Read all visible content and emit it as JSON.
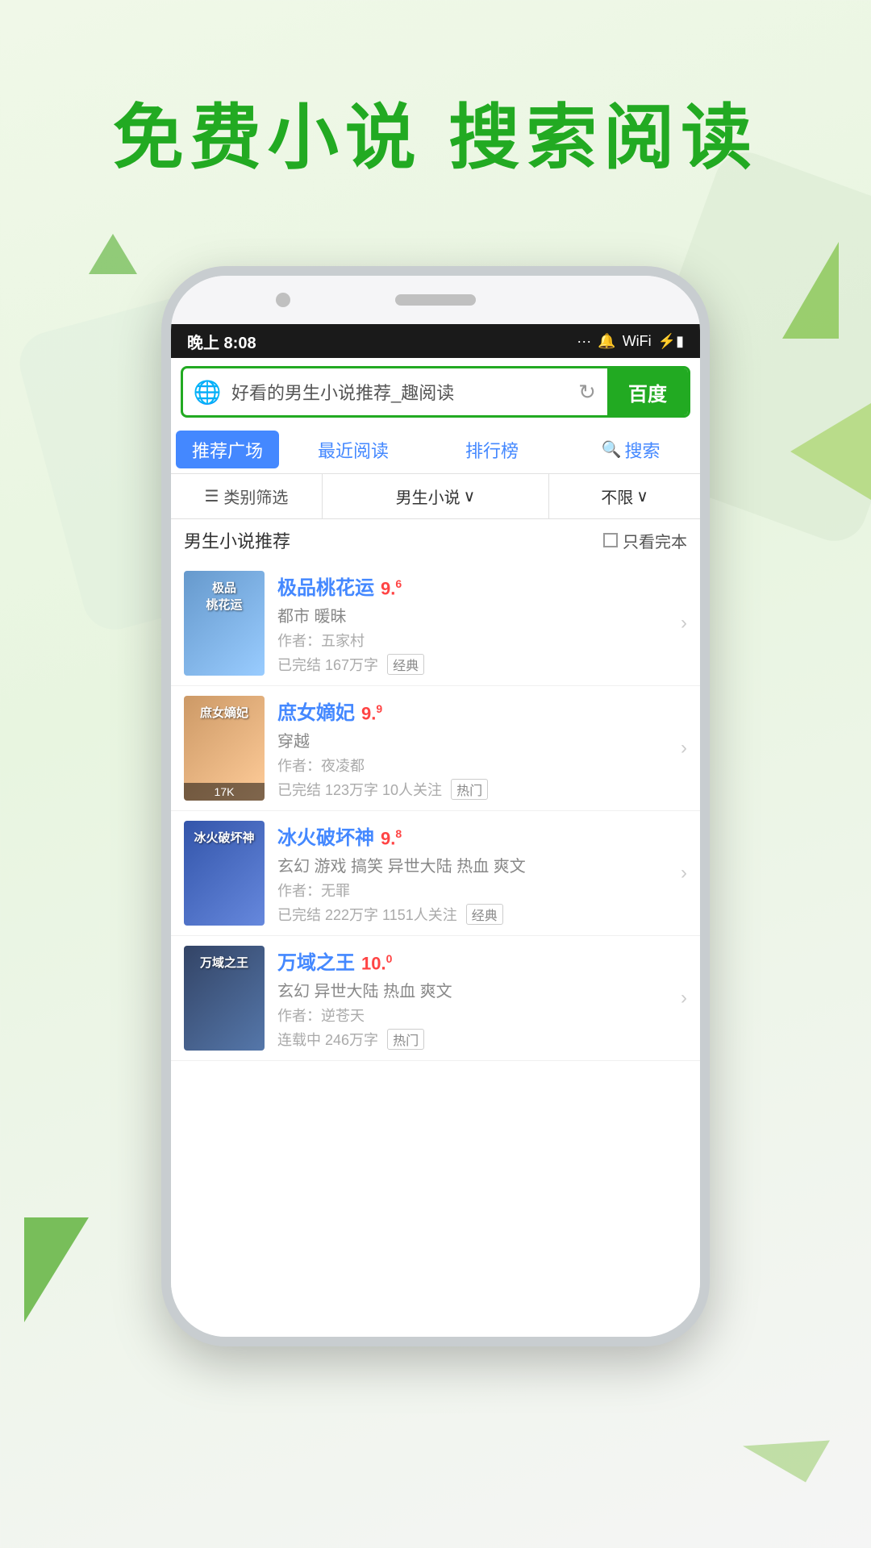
{
  "page": {
    "title": "免费小说  搜索阅读"
  },
  "status_bar": {
    "time": "晚上 8:08",
    "icons": "... 🔔 ⇌ ⊡ ⚡"
  },
  "search_bar": {
    "placeholder": "好看的男生小说推荐_趣阅读",
    "baidu_label": "百度"
  },
  "tabs": [
    {
      "label": "推荐广场",
      "active": true
    },
    {
      "label": "最近阅读",
      "active": false
    },
    {
      "label": "排行榜",
      "active": false
    },
    {
      "label": "搜索",
      "active": false
    }
  ],
  "filters": {
    "category_label": "类别筛选",
    "type_label": "男生小说",
    "type_arrow": "∨",
    "limit_label": "不限",
    "limit_arrow": "∨"
  },
  "section": {
    "title": "男生小说推荐",
    "complete_label": "只看完本"
  },
  "books": [
    {
      "title": "极品桃花运",
      "rating": "9",
      "rating_decimal": "6",
      "genres": "都市 暖昧",
      "author": "作者：五家村",
      "stats": "已完结 167万字",
      "tag": "经典",
      "cover_class": "cover-1",
      "cover_title": "极品\n桃花运"
    },
    {
      "title": "庶女嫡妃",
      "rating": "9",
      "rating_decimal": "9",
      "genres": "穿越",
      "author": "作者：夜凌都",
      "stats": "已完结 123万字 10人关注",
      "tag": "热门",
      "cover_class": "cover-2",
      "cover_title": "庶女嫡妃"
    },
    {
      "title": "冰火破坏神",
      "rating": "9",
      "rating_decimal": "8",
      "genres": "玄幻 游戏 搞笑 异世大陆 热血 爽文",
      "author": "作者：无罪",
      "stats": "已完结 222万字 1151人关注",
      "tag": "经典",
      "cover_class": "cover-3",
      "cover_title": "冰火破坏神"
    },
    {
      "title": "万域之王",
      "rating": "10",
      "rating_decimal": "0",
      "genres": "玄幻 异世大陆 热血 爽文",
      "author": "作者：逆苍天",
      "stats": "连载中 246万字",
      "tag": "热门",
      "cover_class": "cover-4",
      "cover_title": "万域之王"
    }
  ]
}
